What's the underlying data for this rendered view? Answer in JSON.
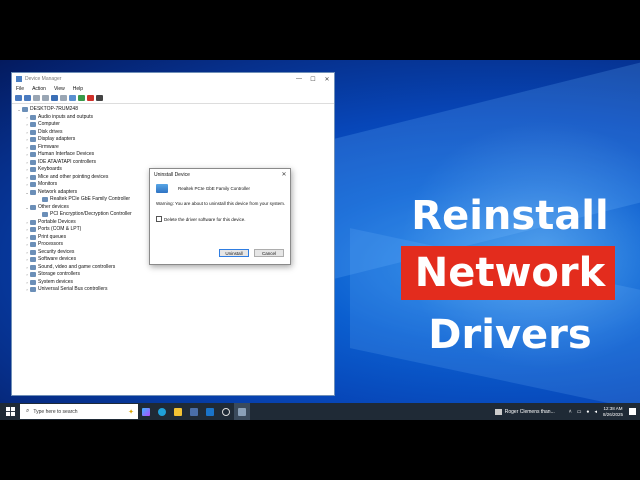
{
  "window": {
    "title": "Device Manager",
    "controls": [
      "—",
      "☐",
      "✕"
    ],
    "menu": [
      "File",
      "Action",
      "View",
      "Help"
    ]
  },
  "tree": [
    {
      "label": "DESKTOP-7RUM248",
      "level": 0,
      "chev": "⌄"
    },
    {
      "label": "Audio inputs and outputs",
      "level": 1,
      "chev": "›"
    },
    {
      "label": "Computer",
      "level": 1,
      "chev": "›"
    },
    {
      "label": "Disk drives",
      "level": 1,
      "chev": "›"
    },
    {
      "label": "Display adapters",
      "level": 1,
      "chev": "›"
    },
    {
      "label": "Firmware",
      "level": 1,
      "chev": "›"
    },
    {
      "label": "Human Interface Devices",
      "level": 1,
      "chev": "›"
    },
    {
      "label": "IDE ATA/ATAPI controllers",
      "level": 1,
      "chev": "›"
    },
    {
      "label": "Keyboards",
      "level": 1,
      "chev": "›"
    },
    {
      "label": "Mice and other pointing devices",
      "level": 1,
      "chev": "›"
    },
    {
      "label": "Monitors",
      "level": 1,
      "chev": "›"
    },
    {
      "label": "Network adapters",
      "level": 1,
      "chev": "⌄"
    },
    {
      "label": "Realtek PCIe GbE Family Controller",
      "level": 2,
      "chev": ""
    },
    {
      "label": "Other devices",
      "level": 1,
      "chev": "⌄"
    },
    {
      "label": "PCI Encryption/Decryption Controller",
      "level": 2,
      "chev": ""
    },
    {
      "label": "Portable Devices",
      "level": 1,
      "chev": "›"
    },
    {
      "label": "Ports (COM & LPT)",
      "level": 1,
      "chev": "›"
    },
    {
      "label": "Print queues",
      "level": 1,
      "chev": "›"
    },
    {
      "label": "Processors",
      "level": 1,
      "chev": "›"
    },
    {
      "label": "Security devices",
      "level": 1,
      "chev": "›"
    },
    {
      "label": "Software devices",
      "level": 1,
      "chev": "›"
    },
    {
      "label": "Sound, video and game controllers",
      "level": 1,
      "chev": "›"
    },
    {
      "label": "Storage controllers",
      "level": 1,
      "chev": "›"
    },
    {
      "label": "System devices",
      "level": 1,
      "chev": "›"
    },
    {
      "label": "Universal Serial Bus controllers",
      "level": 1,
      "chev": "›"
    }
  ],
  "dialog": {
    "title": "Uninstall Device",
    "close": "✕",
    "device_name": "Realtek PCIe GbE Family Controller",
    "warning": "Warning: You are about to uninstall this device from your system.",
    "checkbox_label": "Delete the driver software for this device.",
    "uninstall_button": "Uninstall",
    "cancel_button": "Cancel"
  },
  "headline": {
    "line1": "Reinstall",
    "line2": "Network",
    "line3": "Drivers"
  },
  "taskbar": {
    "search_placeholder": "Type here to search",
    "notification": "Roger Clemens than...",
    "time": "12:38 AM",
    "date": "8/26/2025"
  }
}
